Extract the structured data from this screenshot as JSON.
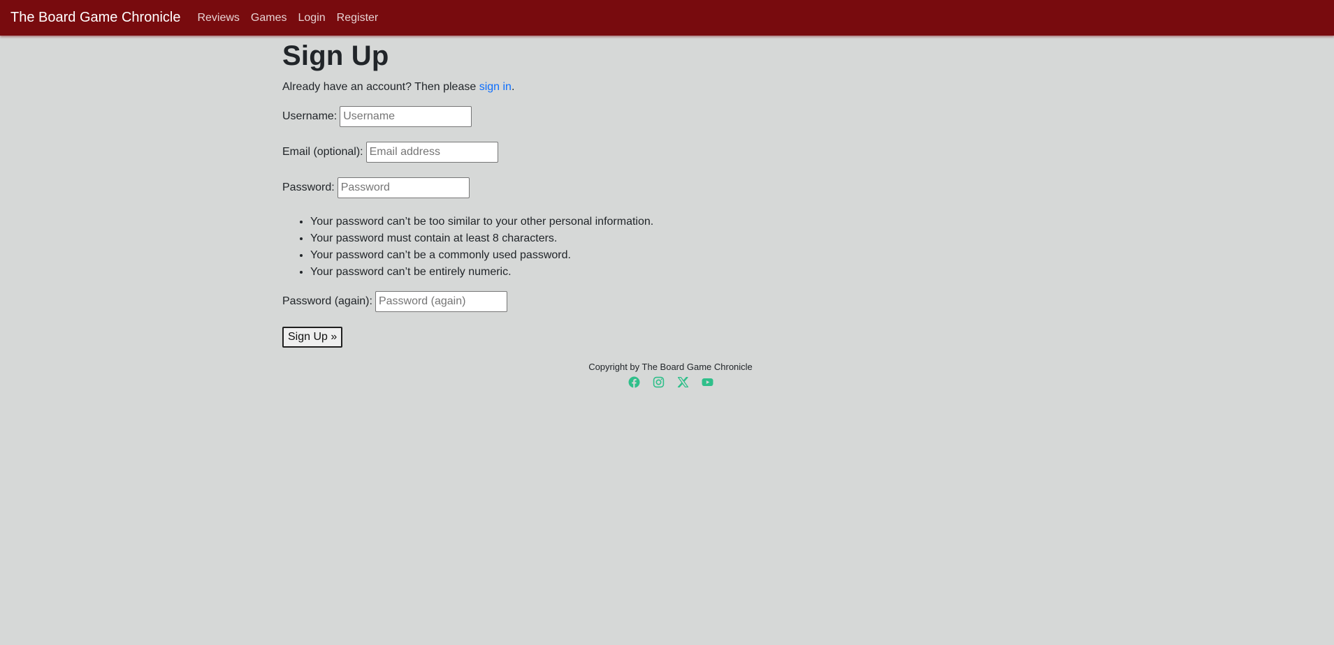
{
  "nav": {
    "brand": "The Board Game Chronicle",
    "links": [
      "Reviews",
      "Games",
      "Login",
      "Register"
    ]
  },
  "page": {
    "title": "Sign Up",
    "intro_prefix": "Already have an account? Then please ",
    "intro_link": "sign in",
    "intro_suffix": "."
  },
  "form": {
    "username": {
      "label": "Username:",
      "placeholder": "Username",
      "value": ""
    },
    "email": {
      "label": "Email (optional):",
      "placeholder": "Email address",
      "value": ""
    },
    "password": {
      "label": "Password:",
      "placeholder": "Password",
      "value": ""
    },
    "password_help": [
      "Your password can’t be too similar to your other personal information.",
      "Your password must contain at least 8 characters.",
      "Your password can’t be a commonly used password.",
      "Your password can’t be entirely numeric."
    ],
    "password2": {
      "label": "Password (again):",
      "placeholder": "Password (again)",
      "value": ""
    },
    "submit_label": "Sign Up »"
  },
  "footer": {
    "copyright": "Copyright by The Board Game Chronicle",
    "social_icons": [
      "facebook-icon",
      "instagram-icon",
      "x-twitter-icon",
      "youtube-icon"
    ]
  },
  "colors": {
    "navbar": "#780b0e",
    "background": "#d6d8d7",
    "link": "#0d6efd",
    "social": "#2fbf8a"
  }
}
